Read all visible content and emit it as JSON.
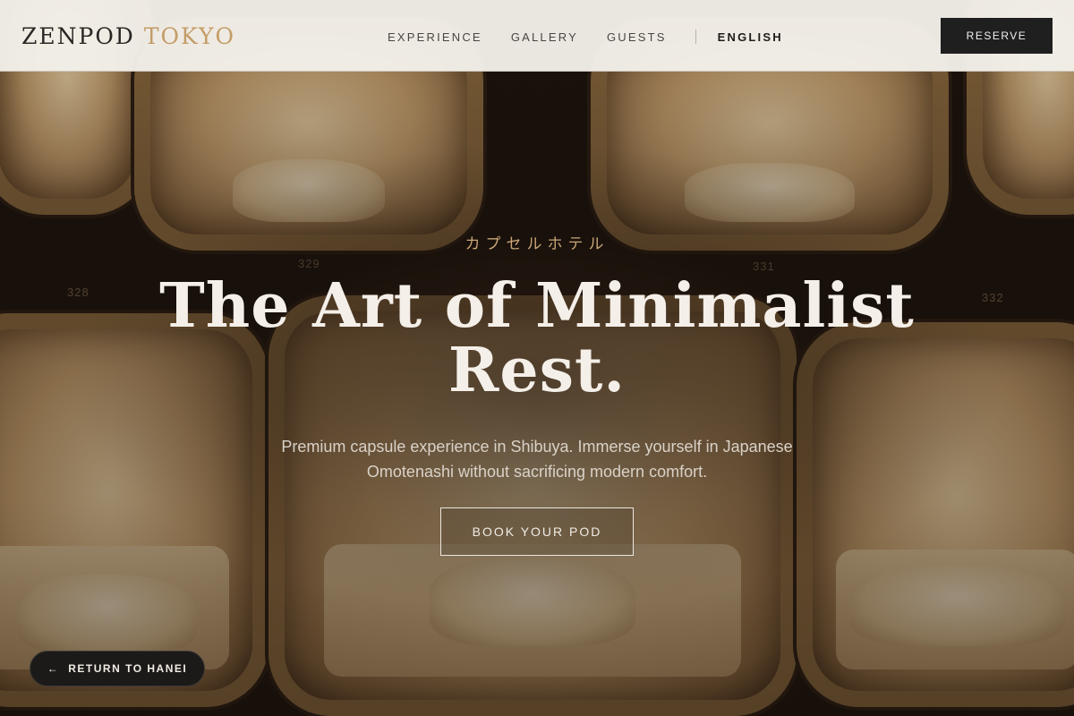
{
  "navbar": {
    "brand_primary": "ZENPOD",
    "brand_accent": "TOKYO",
    "links": [
      "EXPERIENCE",
      "GALLERY",
      "GUESTS"
    ],
    "language": "ENGLISH",
    "reserve_label": "RESERVE"
  },
  "hero": {
    "kana": "カプセルホテル",
    "headline_line1": "The Art of Minimalist",
    "headline_line2": "Rest.",
    "subcopy_line1": "Premium capsule experience in Shibuya. Immerse yourself in Japanese",
    "subcopy_line2": "Omotenashi without sacrificing modern comfort.",
    "cta_label": "BOOK YOUR POD",
    "pod_numbers": [
      "328",
      "329",
      "331",
      "332"
    ]
  },
  "return_button": {
    "arrow": "←",
    "label": "RETURN TO HANEI"
  },
  "colors": {
    "accent": "#c39c67",
    "nav_bg": "#f3f0ea",
    "dark_button": "#1f1f20"
  }
}
